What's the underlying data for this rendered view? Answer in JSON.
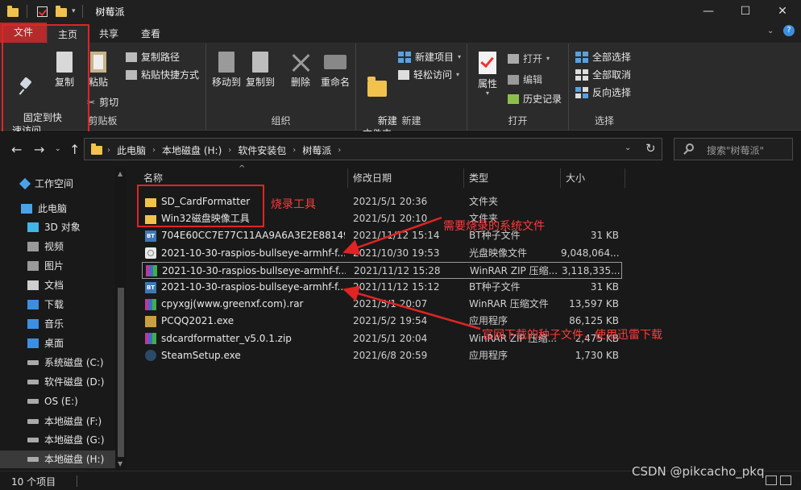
{
  "window": {
    "title": "树莓派",
    "minimize": "—",
    "maximize": "☐",
    "close": "✕"
  },
  "ribbon_tabs": [
    "文件",
    "主页",
    "共享",
    "查看"
  ],
  "ribbon": {
    "clipboard": {
      "pin": "固定到快\n速访问",
      "copy": "复制",
      "paste": "粘贴",
      "copy_path": "复制路径",
      "paste_shortcut": "粘贴快捷方式",
      "cut": "剪切",
      "label": "剪贴板"
    },
    "organize": {
      "move_to": "移动到",
      "copy_to": "复制到",
      "delete": "删除",
      "rename": "重命名",
      "label": "组织"
    },
    "new": {
      "new_folder": "新建\n文件夹",
      "new_item": "新建项目",
      "easy_access": "轻松访问",
      "label": "新建"
    },
    "open": {
      "properties": "属性",
      "open": "打开",
      "edit": "编辑",
      "history": "历史记录",
      "label": "打开"
    },
    "select": {
      "select_all": "全部选择",
      "select_none": "全部取消",
      "invert": "反向选择",
      "label": "选择"
    }
  },
  "address": {
    "crumbs": [
      "此电脑",
      "本地磁盘 (H:)",
      "软件安装包",
      "树莓派"
    ],
    "search_placeholder": "搜索\"树莓派\""
  },
  "sidebar": [
    {
      "label": "工作空间",
      "icon": "star-icon",
      "color": "#4aa3e8"
    },
    {
      "label": "此电脑",
      "icon": "computer-icon",
      "color": "#4aa3e8"
    },
    {
      "label": "3D 对象",
      "icon": "cube-icon",
      "color": "#3fb6e8"
    },
    {
      "label": "视频",
      "icon": "video-icon",
      "color": "#9a9a9a"
    },
    {
      "label": "图片",
      "icon": "picture-icon",
      "color": "#9a9a9a"
    },
    {
      "label": "文档",
      "icon": "document-icon",
      "color": "#cfcfcf"
    },
    {
      "label": "下载",
      "icon": "download-icon",
      "color": "#3c8fe0"
    },
    {
      "label": "音乐",
      "icon": "music-icon",
      "color": "#3c8fe0"
    },
    {
      "label": "桌面",
      "icon": "desktop-icon",
      "color": "#3c8fe0"
    },
    {
      "label": "系统磁盘 (C:)",
      "icon": "drive-icon",
      "color": "#aaaaaa"
    },
    {
      "label": "软件磁盘 (D:)",
      "icon": "drive-icon",
      "color": "#aaaaaa"
    },
    {
      "label": "OS (E:)",
      "icon": "drive-icon",
      "color": "#aaaaaa"
    },
    {
      "label": "本地磁盘 (F:)",
      "icon": "drive-icon",
      "color": "#aaaaaa"
    },
    {
      "label": "本地磁盘 (G:)",
      "icon": "drive-icon",
      "color": "#aaaaaa"
    },
    {
      "label": "本地磁盘 (H:)",
      "icon": "drive-icon",
      "color": "#aaaaaa"
    }
  ],
  "columns": [
    "名称",
    "修改日期",
    "类型",
    "大小"
  ],
  "files": [
    {
      "name": "SD_CardFormatter",
      "date": "2021/5/1 20:36",
      "type": "文件夹",
      "size": "",
      "icon": "folder"
    },
    {
      "name": "Win32磁盘映像工具",
      "date": "2021/5/1 20:10",
      "type": "文件夹",
      "size": "",
      "icon": "folder"
    },
    {
      "name": "704E60CC7E77C11AA9A6A3E2E88149...",
      "date": "2021/11/12 15:14",
      "type": "BT种子文件",
      "size": "31 KB",
      "icon": "bt"
    },
    {
      "name": "2021-10-30-raspios-bullseye-armhf-f...",
      "date": "2021/10/30 19:53",
      "type": "光盘映像文件",
      "size": "9,048,064...",
      "icon": "iso"
    },
    {
      "name": "2021-10-30-raspios-bullseye-armhf-f...",
      "date": "2021/11/12 15:28",
      "type": "WinRAR ZIP 压缩...",
      "size": "3,118,335...",
      "icon": "rar"
    },
    {
      "name": "2021-10-30-raspios-bullseye-armhf-f...",
      "date": "2021/11/12 15:12",
      "type": "BT种子文件",
      "size": "31 KB",
      "icon": "bt"
    },
    {
      "name": "cpyxgj(www.greenxf.com).rar",
      "date": "2021/5/1 20:07",
      "type": "WinRAR 压缩文件",
      "size": "13,597 KB",
      "icon": "rar"
    },
    {
      "name": "PCQQ2021.exe",
      "date": "2021/5/2 19:54",
      "type": "应用程序",
      "size": "86,125 KB",
      "icon": "exe"
    },
    {
      "name": "sdcardformatter_v5.0.1.zip",
      "date": "2021/5/1 20:04",
      "type": "WinRAR ZIP 压缩...",
      "size": "2,475 KB",
      "icon": "rar"
    },
    {
      "name": "SteamSetup.exe",
      "date": "2021/6/8 20:59",
      "type": "应用程序",
      "size": "1,730 KB",
      "icon": "steam"
    }
  ],
  "annotations": {
    "burn_tool": "烧录工具",
    "system_file": "需要烧录的系统文件",
    "torrent_note": "官网下载的种子文件，使用迅雷下载"
  },
  "status": {
    "count": "10 个项目"
  },
  "watermark": "CSDN @pikcacho_pkq"
}
